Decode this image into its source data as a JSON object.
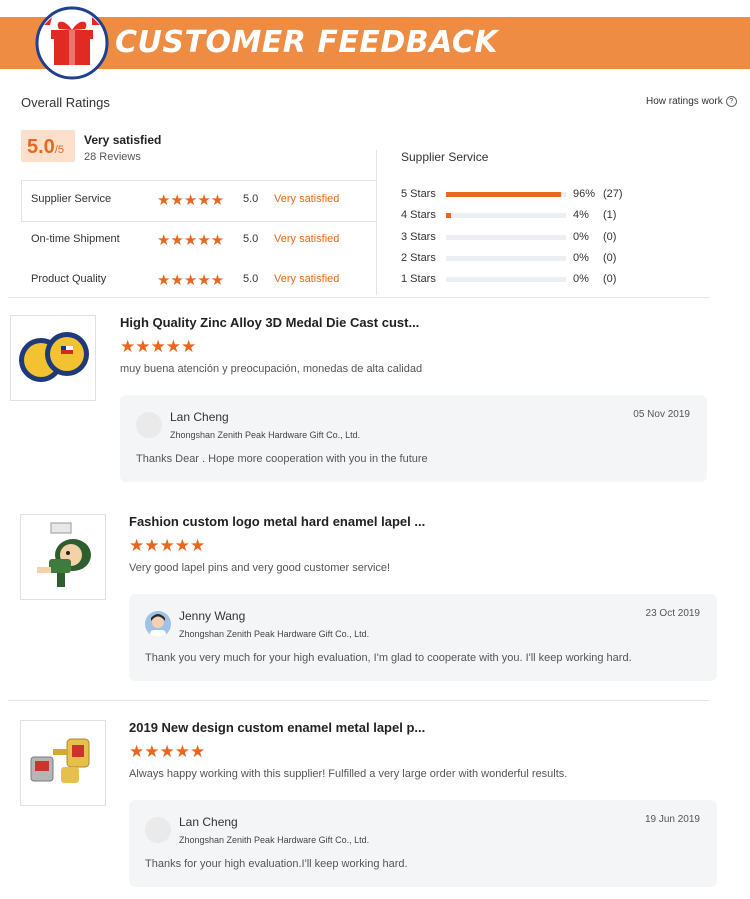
{
  "banner": {
    "title": "CUSTOMER FEEDBACK"
  },
  "colors": {
    "accent": "#e8671d",
    "banner": "#ee8c44",
    "reply_bg": "#f4f5f7"
  },
  "ratings": {
    "title": "Overall Ratings",
    "how_link": "How ratings work",
    "score": "5.0",
    "score_den": "/5",
    "satisfaction": "Very satisfied",
    "reviews": "28 Reviews",
    "categories": [
      {
        "label": "Supplier Service",
        "stars": "★★★★★",
        "score": "5.0",
        "status": "Very satisfied"
      },
      {
        "label": "On-time Shipment",
        "stars": "★★★★★",
        "score": "5.0",
        "status": "Very satisfied"
      },
      {
        "label": "Product Quality",
        "stars": "★★★★★",
        "score": "5.0",
        "status": "Very satisfied"
      }
    ],
    "service_title": "Supplier Service",
    "distribution": [
      {
        "label": "5 Stars",
        "pct": "96%",
        "count": "(27)",
        "fill": 96
      },
      {
        "label": "4 Stars",
        "pct": "4%",
        "count": "(1)",
        "fill": 4
      },
      {
        "label": "3 Stars",
        "pct": "0%",
        "count": "(0)",
        "fill": 0
      },
      {
        "label": "2 Stars",
        "pct": "0%",
        "count": "(0)",
        "fill": 0
      },
      {
        "label": "1 Stars",
        "pct": "0%",
        "count": "(0)",
        "fill": 0
      }
    ]
  },
  "reviews": [
    {
      "product": "High Quality Zinc Alloy 3D Medal Die Cast cust...",
      "stars": "★★★★★",
      "text": "muy buena atención y  preocupación, monedas de alta calidad",
      "reply": {
        "name": "Lan Cheng",
        "company": "Zhongshan Zenith Peak Hardware Gift Co., Ltd.",
        "date": "05 Nov 2019",
        "message": "Thanks Dear . Hope more cooperation with you in the future"
      }
    },
    {
      "product": "Fashion custom logo metal hard enamel lapel ...",
      "stars": "★★★★★",
      "text": "Very good lapel pins and very good customer service!",
      "reply": {
        "name": "Jenny Wang",
        "company": "Zhongshan Zenith Peak Hardware Gift Co., Ltd.",
        "date": "23 Oct 2019",
        "message": "Thank you very much for your high evaluation,  I'm glad to cooperate with you. I'll keep working hard."
      }
    },
    {
      "product": "2019 New design custom enamel metal lapel p...",
      "stars": "★★★★★",
      "text": "Always happy working with this supplier! Fulfilled a very large order with wonderful results.",
      "reply": {
        "name": "Lan Cheng",
        "company": "Zhongshan Zenith Peak Hardware Gift Co., Ltd.",
        "date": "19 Jun 2019",
        "message": "Thanks for your high evaluation.I'll keep working hard."
      }
    }
  ]
}
